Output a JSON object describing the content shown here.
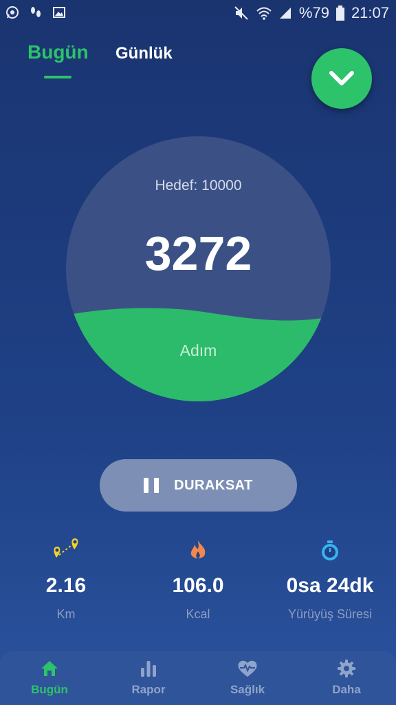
{
  "status_bar": {
    "battery_percent": "%79",
    "time": "21:07",
    "left_icons": [
      "whatsapp-icon",
      "footsteps-icon",
      "image-icon"
    ],
    "right_icons": [
      "mute-icon",
      "wifi-icon",
      "signal-icon",
      "battery-icon"
    ]
  },
  "tabs": [
    {
      "label": "Bugün",
      "active": true
    },
    {
      "label": "Günlük",
      "active": false
    }
  ],
  "accent_color": "#2cc36b",
  "progress": {
    "goal_label": "Hedef: 10000",
    "steps": "3272",
    "unit": "Adım",
    "fraction": 0.3272
  },
  "pause_button": {
    "label": "DURAKSAT",
    "icon": "pause-icon"
  },
  "stats": [
    {
      "icon": "route-pin-icon",
      "value": "2.16",
      "label": "Km"
    },
    {
      "icon": "flame-icon",
      "value": "106.0",
      "label": "Kcal"
    },
    {
      "icon": "stopwatch-icon",
      "value": "0sa 24dk",
      "label": "Yürüyüş Süresi"
    }
  ],
  "bottom_nav": [
    {
      "icon": "home-icon",
      "label": "Bugün",
      "active": true
    },
    {
      "icon": "bar-chart-icon",
      "label": "Rapor",
      "active": false
    },
    {
      "icon": "heart-pulse-icon",
      "label": "Sağlık",
      "active": false
    },
    {
      "icon": "gear-icon",
      "label": "Daha",
      "active": false
    }
  ]
}
